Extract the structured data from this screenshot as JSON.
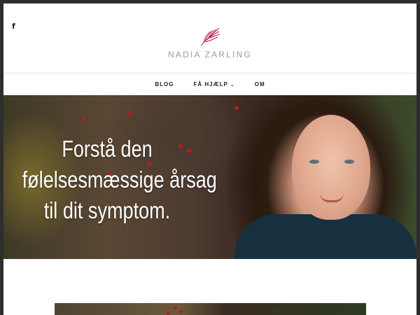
{
  "site": {
    "logo_text": "NADIA ZARLING"
  },
  "social": {
    "facebook_glyph": "f"
  },
  "nav": {
    "items": [
      {
        "label": "BLOG",
        "has_dropdown": false
      },
      {
        "label": "FÅ HJÆLP",
        "has_dropdown": true
      },
      {
        "label": "OM",
        "has_dropdown": false
      }
    ]
  },
  "hero": {
    "headline_lines": [
      "Forstå den",
      "følelsesmæssige årsag",
      "til dit symptom."
    ]
  },
  "icons": {
    "facebook": "facebook-icon",
    "logo": "feather-logo-icon",
    "dropdown": "chevron-down-icon"
  },
  "colors": {
    "logo_accent": "#c2185b",
    "logo_text": "#9a9a9a",
    "nav_text": "#222222",
    "frame": "#2e2e2e"
  }
}
